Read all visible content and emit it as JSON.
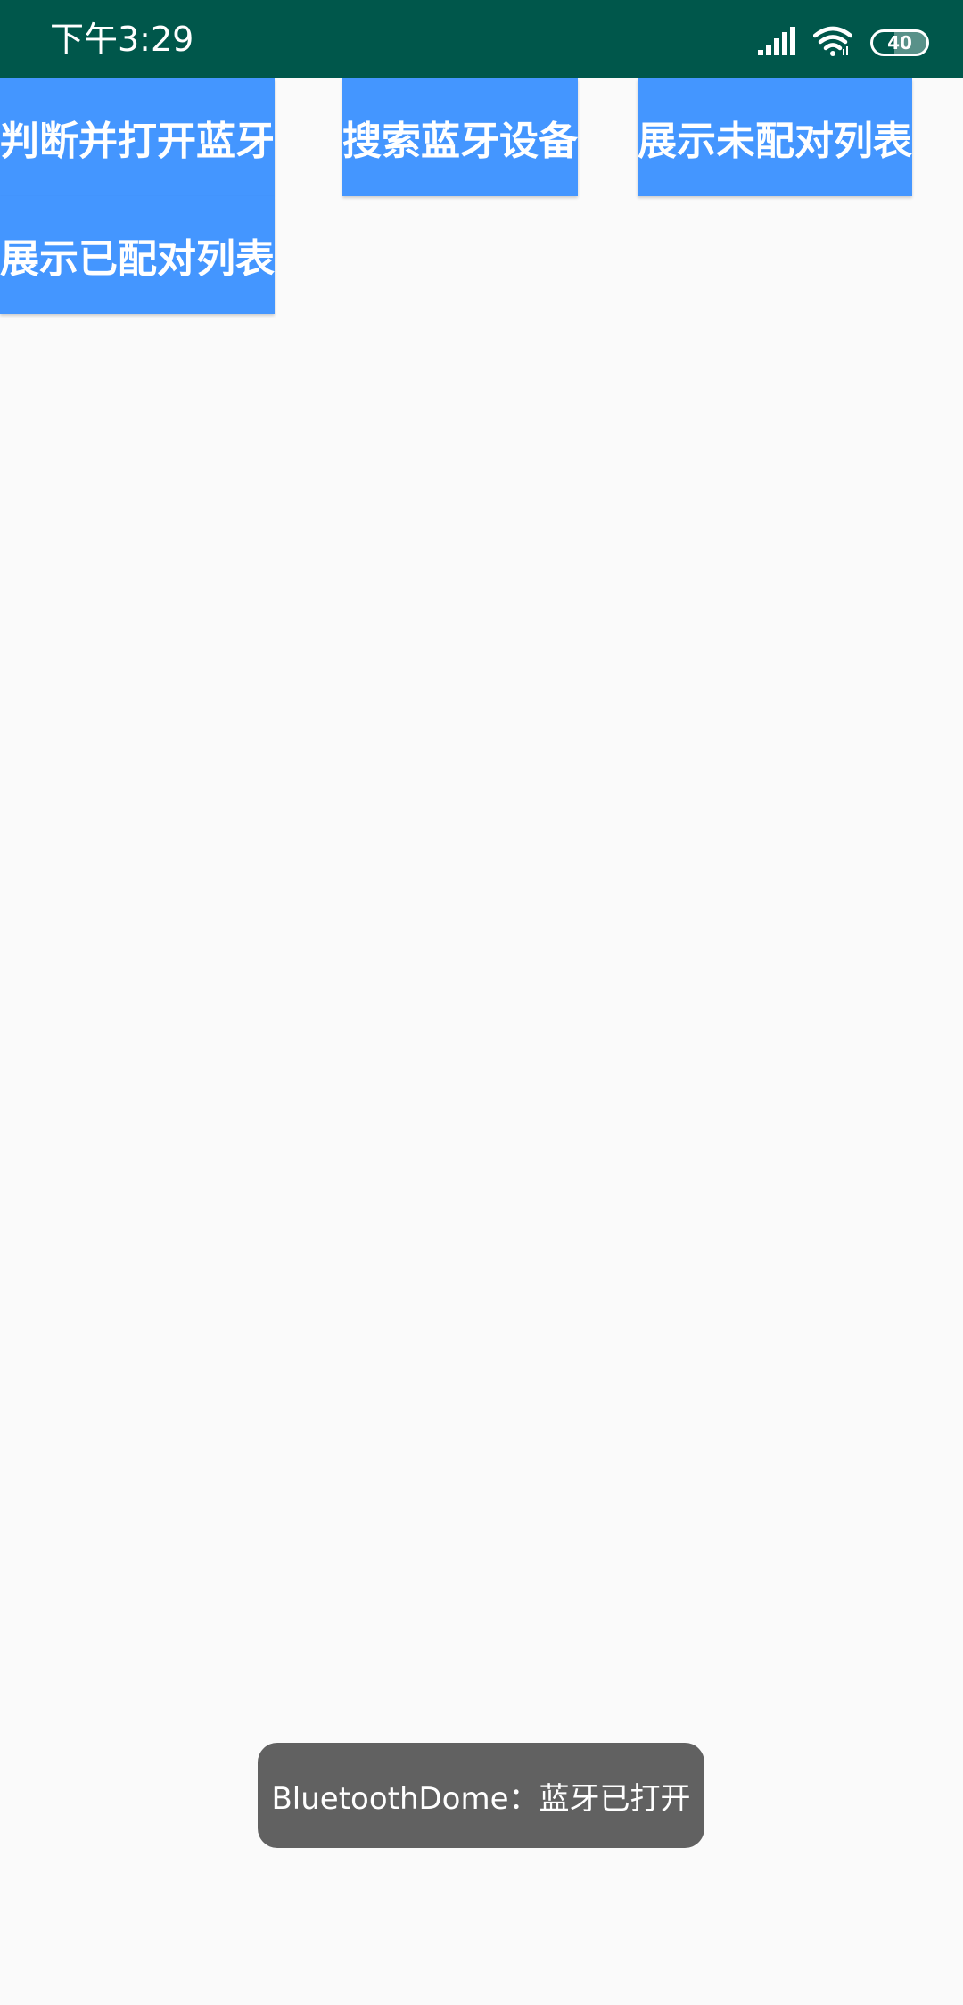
{
  "status_bar": {
    "time": "下午3:29",
    "battery_level": "40",
    "color": "#00574b",
    "icons": [
      "signal-icon",
      "wifi-icon",
      "battery-icon"
    ]
  },
  "buttons": {
    "check_open_bluetooth": "判断并打开蓝牙",
    "search_devices": "搜索蓝牙设备",
    "show_unpaired": "展示未配对列表",
    "show_paired": "展示已配对列表",
    "color": "#4496ff"
  },
  "toast": {
    "message": "BluetoothDome：蓝牙已打开",
    "color": "#616161"
  }
}
